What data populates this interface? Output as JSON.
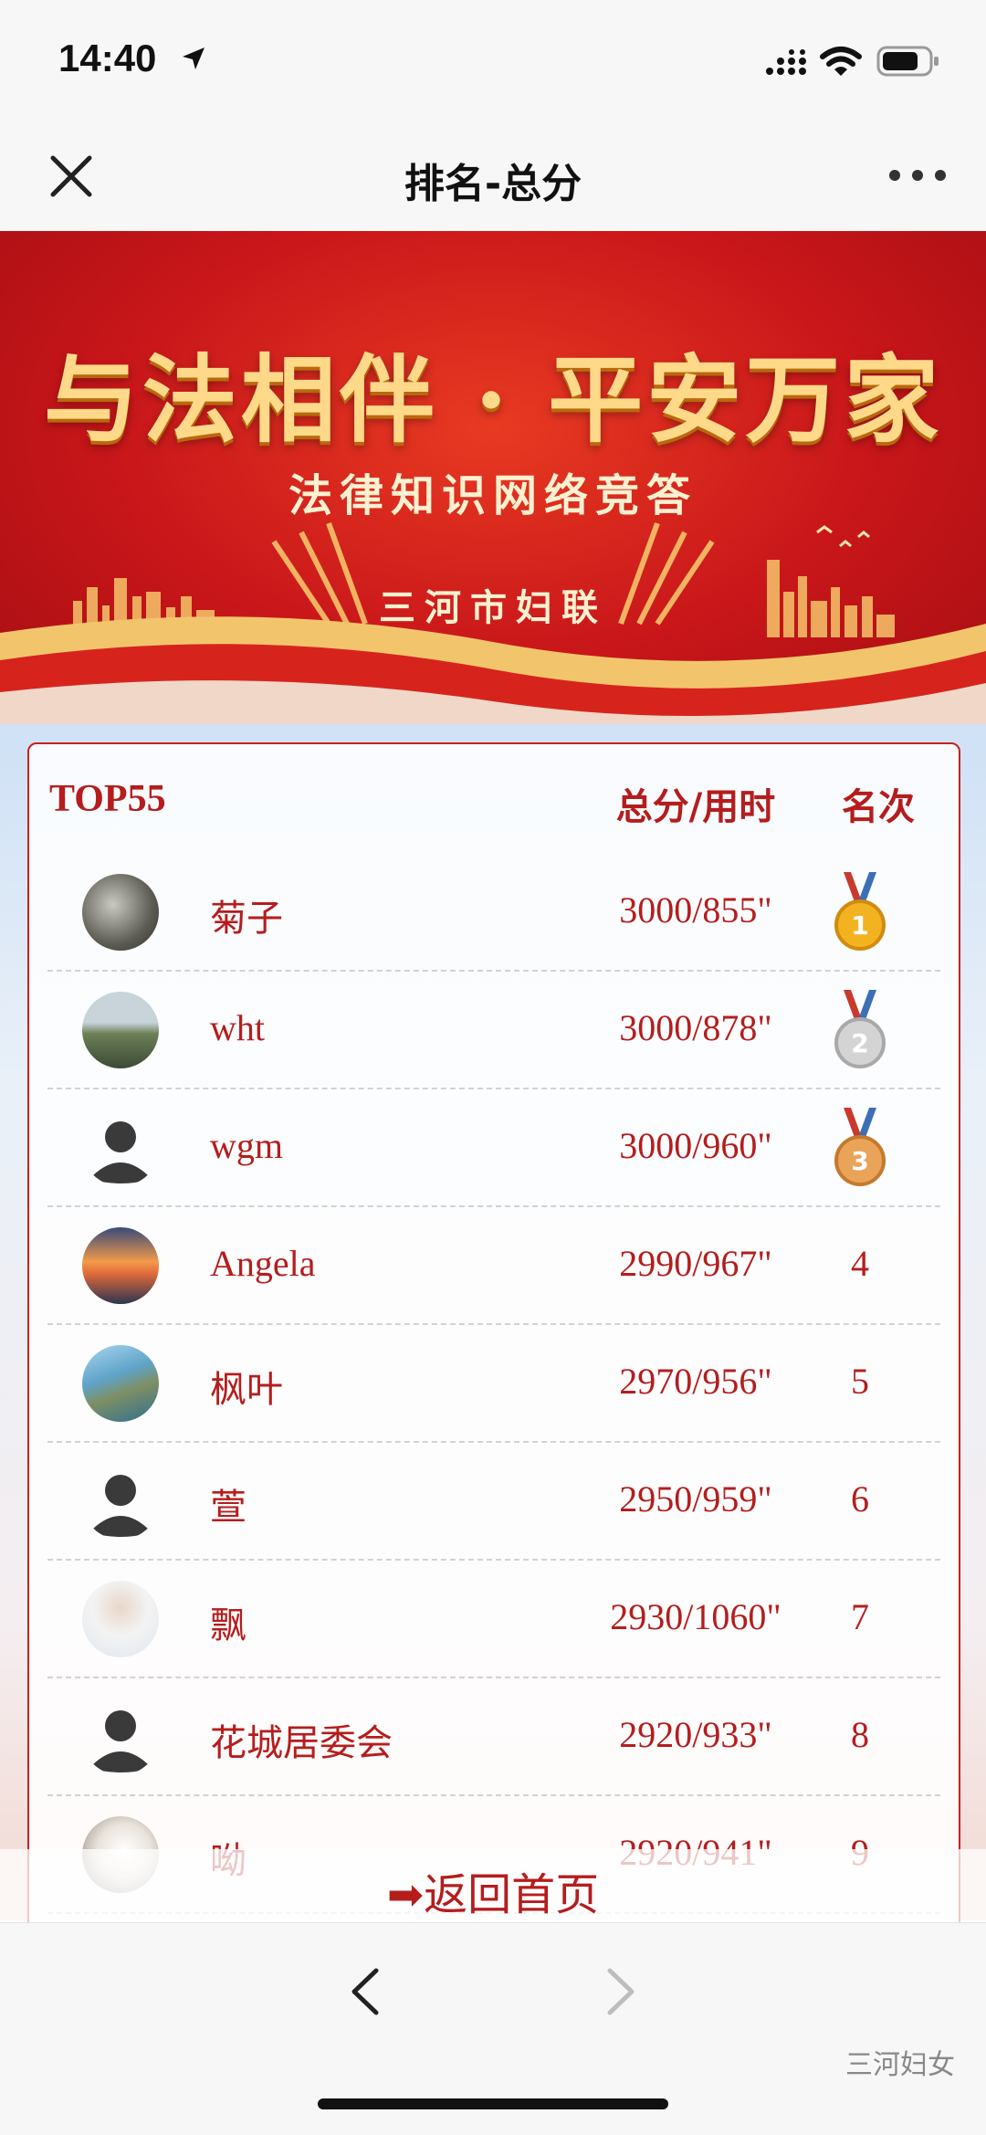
{
  "status_bar": {
    "time": "14:40"
  },
  "nav": {
    "title": "排名-总分"
  },
  "banner": {
    "headline": "与法相伴 · 平安万家",
    "subtitle": "法律知识网络竞答",
    "organizer": "三河市妇联"
  },
  "ranking": {
    "top_label": "TOP55",
    "score_header": "总分/用时",
    "rank_header": "名次",
    "rows": [
      {
        "name": "菊子",
        "score": "3000/855\"",
        "rank": "1",
        "medal": "gold"
      },
      {
        "name": "wht",
        "score": "3000/878\"",
        "rank": "2",
        "medal": "silver"
      },
      {
        "name": "wgm",
        "score": "3000/960\"",
        "rank": "3",
        "medal": "bronze"
      },
      {
        "name": "Angela",
        "score": "2990/967\"",
        "rank": "4"
      },
      {
        "name": "枫叶",
        "score": "2970/956\"",
        "rank": "5"
      },
      {
        "name": "萱",
        "score": "2950/959\"",
        "rank": "6"
      },
      {
        "name": "飘",
        "score": "2930/1060\"",
        "rank": "7"
      },
      {
        "name": "花城居委会",
        "score": "2920/933\"",
        "rank": "8"
      },
      {
        "name": "呦",
        "score": "2920/941\"",
        "rank": "9"
      }
    ]
  },
  "back_home": {
    "label": "➡返回首页"
  },
  "watermark": "三河妇女",
  "colors": {
    "accent": "#b51d1d",
    "banner_red": "#c8161a",
    "gold_text": "#ffd98a"
  }
}
